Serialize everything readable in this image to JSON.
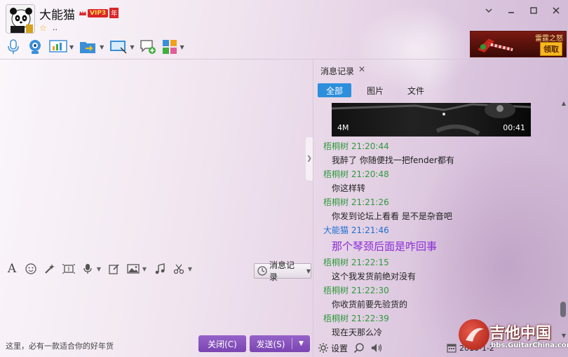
{
  "header": {
    "username": "大能猫",
    "vip_label": "VIP3",
    "vip_year": "年",
    "signature": ".."
  },
  "window_controls": [
    "minimize",
    "maximize",
    "close"
  ],
  "toolbar": {
    "items": [
      {
        "name": "microphone-icon"
      },
      {
        "name": "webcam-icon"
      },
      {
        "name": "remote-assist-icon"
      },
      {
        "name": "file-transfer-icon"
      },
      {
        "name": "screen-share-icon"
      },
      {
        "name": "add-chat-icon"
      },
      {
        "name": "apps-icon"
      }
    ]
  },
  "promo": {
    "title": "雷霆之怒",
    "button": "领取"
  },
  "compose": {
    "history_button": "消息记录",
    "footer_ad": "这里，必有一款适合你的好年货",
    "close_button": "关闭(C)",
    "send_button": "发送(S)"
  },
  "history": {
    "title": "消息记录",
    "tabs": [
      {
        "label": "全部",
        "active": true
      },
      {
        "label": "图片",
        "active": false
      },
      {
        "label": "文件",
        "active": false
      }
    ],
    "video": {
      "size": "4M",
      "duration": "00:41"
    },
    "messages": [
      {
        "sender": "梧桐树",
        "time": "21:20:44",
        "text": "我醉了 你随便找一把fender都有",
        "self": false
      },
      {
        "sender": "梧桐树",
        "time": "21:20:48",
        "text": "你这样转",
        "self": false
      },
      {
        "sender": "梧桐树",
        "time": "21:21:26",
        "text": "你发到论坛上看看 是不是杂音吧",
        "self": false
      },
      {
        "sender": "大能猫",
        "time": "21:21:46",
        "text": "那个琴颈后面是咋回事",
        "self": true
      },
      {
        "sender": "梧桐树",
        "time": "21:22:15",
        "text": "这个我发货前绝对没有",
        "self": false
      },
      {
        "sender": "梧桐树",
        "time": "21:22:30",
        "text": "你收货前要先验货的",
        "self": false
      },
      {
        "sender": "梧桐树",
        "time": "21:22:39",
        "text": "现在天那么冷",
        "self": false
      }
    ],
    "footer": {
      "settings_label": "设置",
      "date": "2016-1-2"
    }
  },
  "watermark": {
    "title": "吉他中国",
    "url": "bbs.GuitarChina.com"
  }
}
